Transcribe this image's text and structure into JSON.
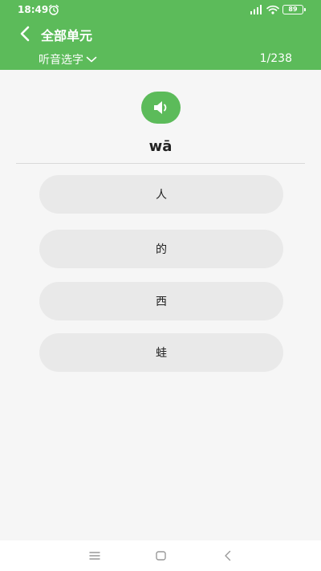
{
  "status_bar": {
    "time": "18:49",
    "battery": "89",
    "icons": [
      "alarm-icon",
      "signal-icon",
      "wifi-icon",
      "battery-icon"
    ]
  },
  "app_bar": {
    "back_icon": "chevron-left-icon",
    "title": "全部单元",
    "mode_label": "听音选字",
    "mode_icon": "chevron-down-icon",
    "progress": "1/238"
  },
  "question": {
    "speaker_icon": "speaker-icon",
    "pinyin": "wā"
  },
  "options": [
    {
      "label": "人"
    },
    {
      "label": "的"
    },
    {
      "label": "西"
    },
    {
      "label": "蛙"
    }
  ],
  "nav_bar": {
    "icons": [
      "menu-icon",
      "home-icon",
      "back-icon"
    ]
  },
  "colors": {
    "accent": "#5cbb5a",
    "option_bg": "#e9e9e9",
    "page_bg": "#f6f6f6"
  }
}
